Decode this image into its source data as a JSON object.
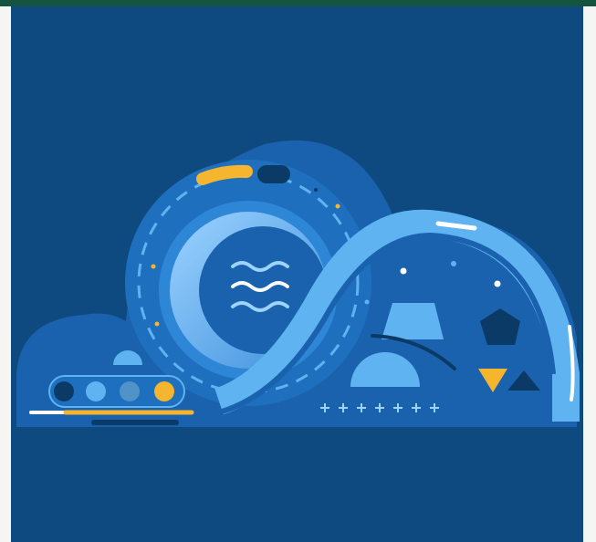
{
  "image": {
    "kind": "illustration",
    "motif": "cloud",
    "colors": {
      "page_background": "#ffffff",
      "top_strip": "#15553f",
      "panel_background": "#0e4a80",
      "cloud_body": "#1a62ad",
      "cloud_inner": "#1f6fbf",
      "light_blue": "#5fb3f0",
      "pale_blue": "#9dd3ff",
      "accent_yellow": "#f5b52e",
      "white": "#ffffff",
      "dark_navy": "#0b3a66"
    },
    "elements": [
      "wave-icon",
      "pentagon-icon",
      "triangle-icon",
      "half-circle-icon",
      "plus-icon",
      "dial-ring",
      "dot-indicators"
    ]
  }
}
